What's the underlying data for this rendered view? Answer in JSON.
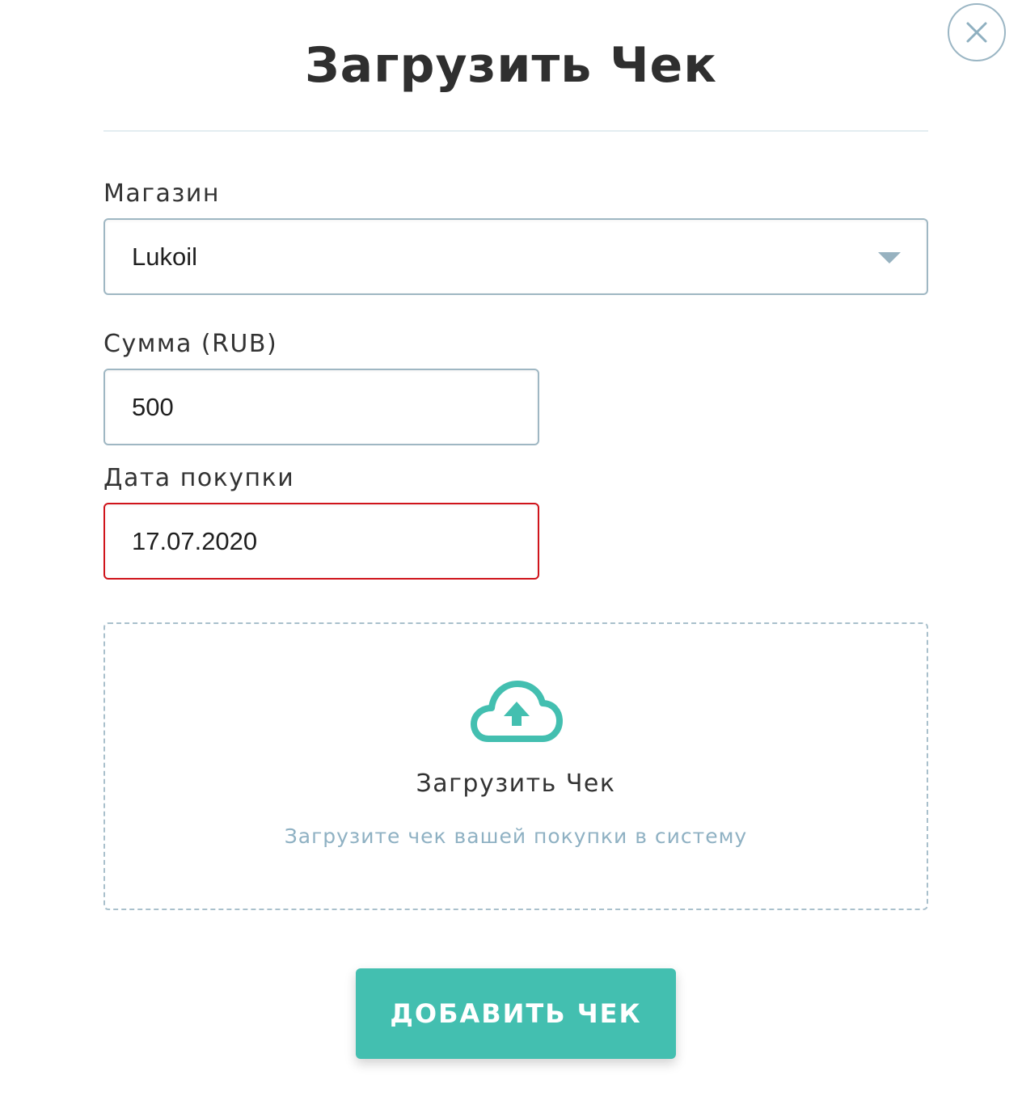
{
  "modal": {
    "title": "Загрузить Чек",
    "close_icon": "close-icon"
  },
  "form": {
    "store": {
      "label": "Магазин",
      "value": "Lukoil"
    },
    "amount": {
      "label": "Сумма (RUB)",
      "value": "500"
    },
    "date": {
      "label": "Дата покупки",
      "value": "17.07.2020",
      "state": "error",
      "border_color": "#d0141b"
    }
  },
  "upload": {
    "icon": "cloud-upload-icon",
    "title": "Загрузить Чек",
    "subtitle": "Загрузите чек вашей покупки в систему"
  },
  "submit": {
    "label": "ДОБАВИТЬ ЧЕК"
  },
  "colors": {
    "accent": "#43bfb0",
    "field_border": "#9fb7c3",
    "error": "#d0141b",
    "muted_text": "#8fb1c3"
  }
}
